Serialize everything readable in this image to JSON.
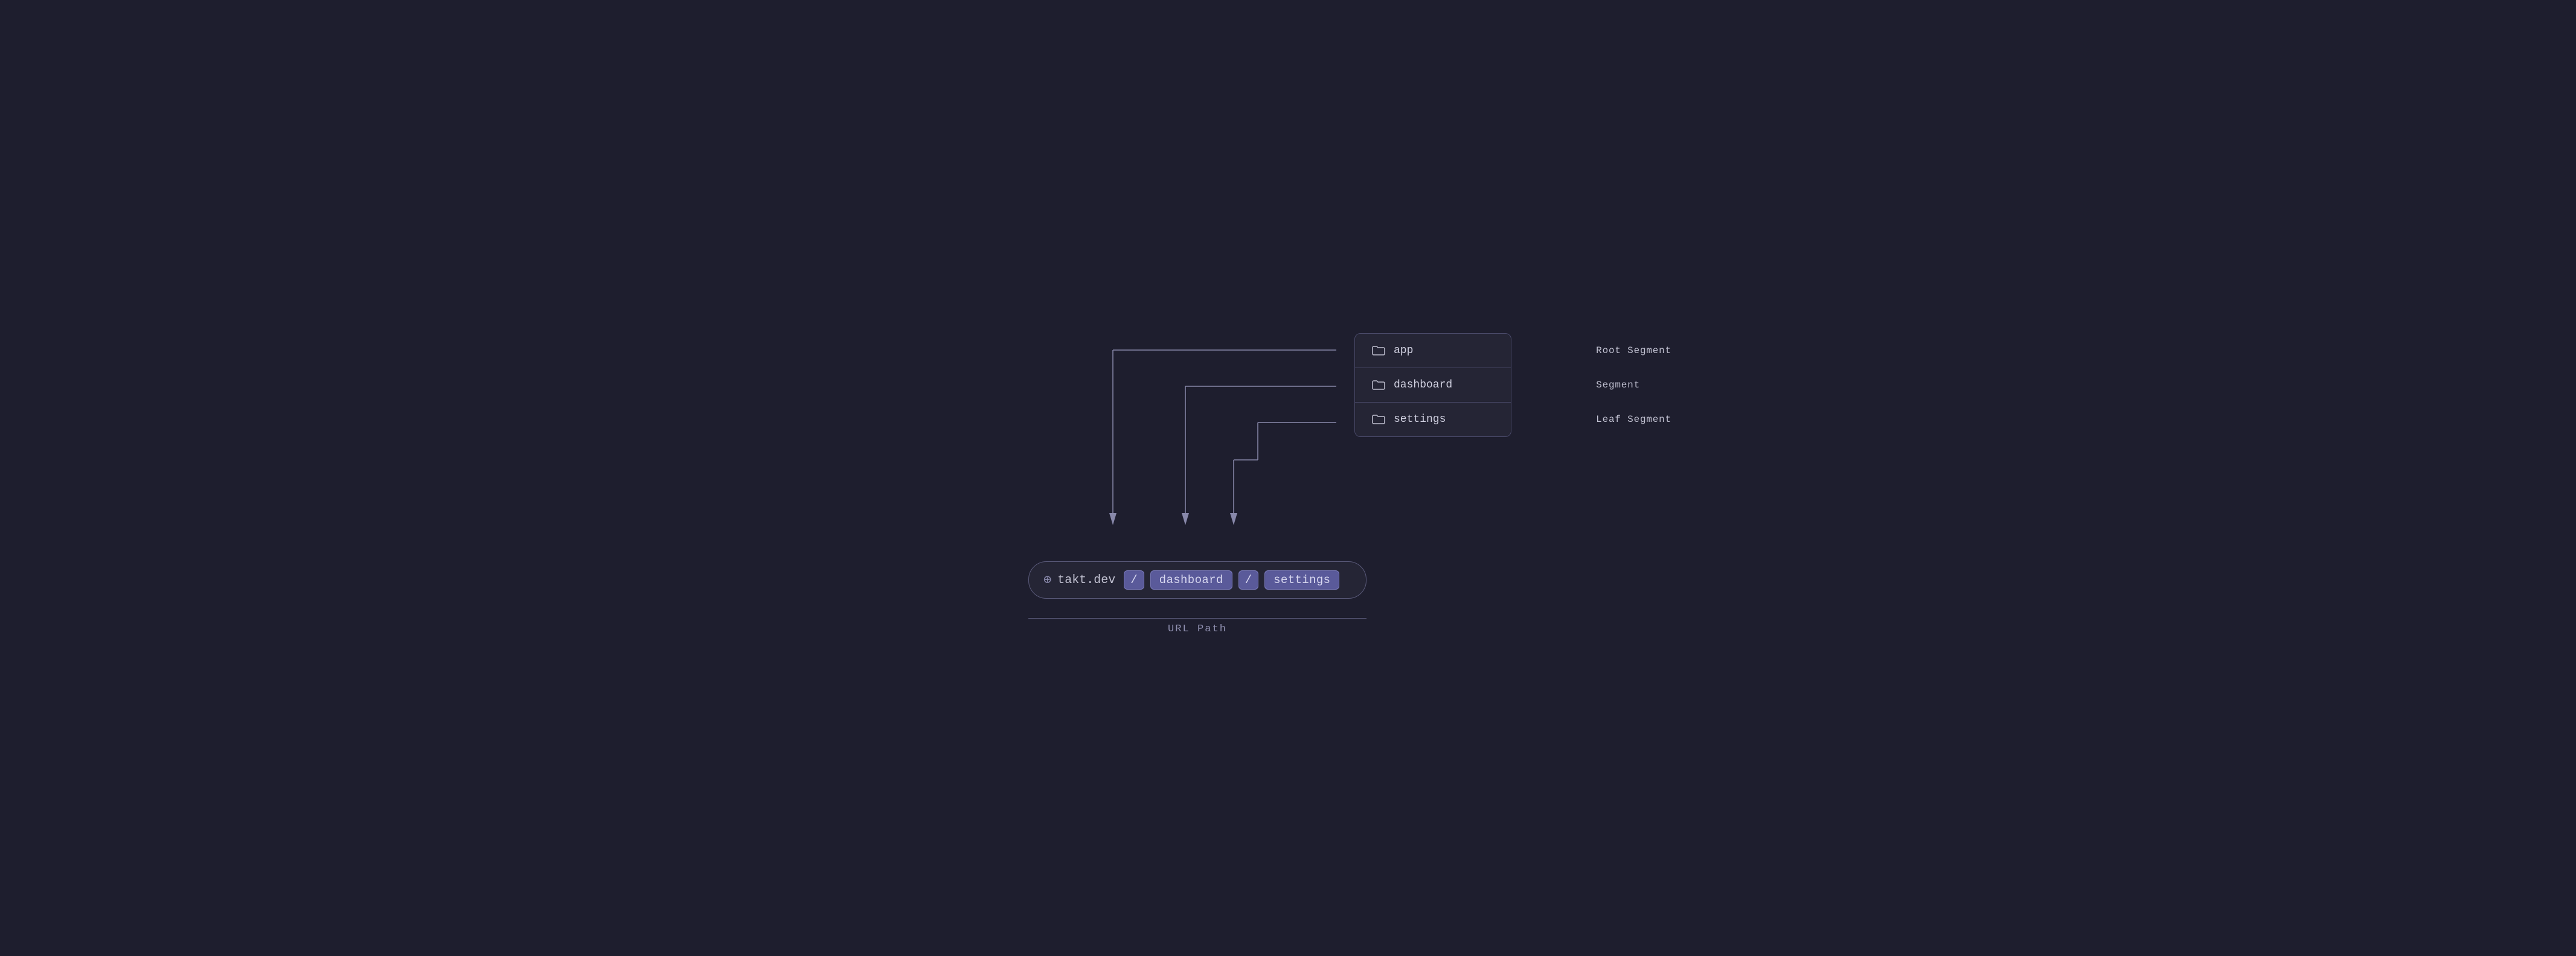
{
  "diagram": {
    "background_color": "#1e1e2e",
    "folder_tree": {
      "items": [
        {
          "label": "app",
          "segment_type": "Root Segment"
        },
        {
          "label": "dashboard",
          "segment_type": "Segment"
        },
        {
          "label": "settings",
          "segment_type": "Leaf Segment"
        }
      ]
    },
    "url_bar": {
      "domain": "takt.dev",
      "segments": [
        "dashboard",
        "settings"
      ],
      "slashes": [
        "/",
        "/"
      ]
    },
    "url_path_label": "URL Path"
  }
}
